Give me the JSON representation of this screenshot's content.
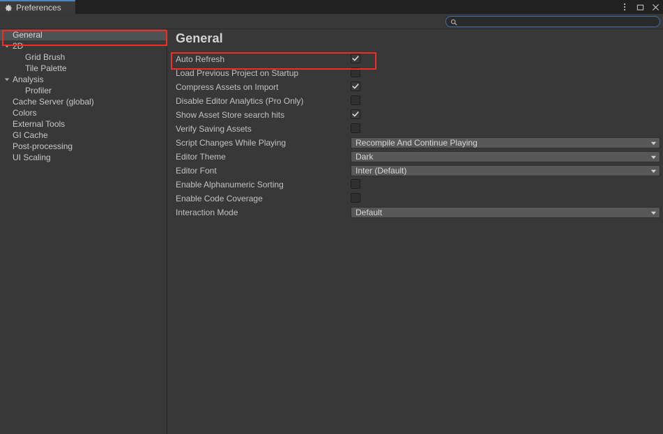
{
  "window": {
    "tab_label": "Preferences",
    "tab_icon": "gear-icon",
    "controls": [
      {
        "name": "more-options-icon",
        "glyph": "vertical-dots"
      },
      {
        "name": "maximize-icon",
        "glyph": "square"
      },
      {
        "name": "close-icon",
        "glyph": "x"
      }
    ],
    "accent_color": "#4a85c4"
  },
  "search": {
    "icon": "search-icon",
    "value": "",
    "placeholder": ""
  },
  "sidebar": {
    "items": [
      {
        "label": "General",
        "indent": 0,
        "twisty": "none",
        "selected": true
      },
      {
        "label": "2D",
        "indent": 0,
        "twisty": "expanded",
        "selected": false
      },
      {
        "label": "Grid Brush",
        "indent": 1,
        "twisty": "none",
        "selected": false
      },
      {
        "label": "Tile Palette",
        "indent": 1,
        "twisty": "none",
        "selected": false
      },
      {
        "label": "Analysis",
        "indent": 0,
        "twisty": "expanded",
        "selected": false
      },
      {
        "label": "Profiler",
        "indent": 1,
        "twisty": "none",
        "selected": false
      },
      {
        "label": "Cache Server (global)",
        "indent": 0,
        "twisty": "none",
        "selected": false
      },
      {
        "label": "Colors",
        "indent": 0,
        "twisty": "none",
        "selected": false
      },
      {
        "label": "External Tools",
        "indent": 0,
        "twisty": "none",
        "selected": false
      },
      {
        "label": "GI Cache",
        "indent": 0,
        "twisty": "none",
        "selected": false
      },
      {
        "label": "Post-processing",
        "indent": 0,
        "twisty": "none",
        "selected": false
      },
      {
        "label": "UI Scaling",
        "indent": 0,
        "twisty": "none",
        "selected": false
      }
    ]
  },
  "main": {
    "title": "General",
    "settings": [
      {
        "label": "Auto Refresh",
        "type": "checkbox",
        "checked": true
      },
      {
        "label": "Load Previous Project on Startup",
        "type": "checkbox",
        "checked": false
      },
      {
        "label": "Compress Assets on Import",
        "type": "checkbox",
        "checked": true
      },
      {
        "label": "Disable Editor Analytics (Pro Only)",
        "type": "checkbox",
        "checked": false
      },
      {
        "label": "Show Asset Store search hits",
        "type": "checkbox",
        "checked": true
      },
      {
        "label": "Verify Saving Assets",
        "type": "checkbox",
        "checked": false
      },
      {
        "label": "Script Changes While Playing",
        "type": "dropdown",
        "value": "Recompile And Continue Playing"
      },
      {
        "label": "Editor Theme",
        "type": "dropdown",
        "value": "Dark"
      },
      {
        "label": "Editor Font",
        "type": "dropdown",
        "value": "Inter (Default)"
      },
      {
        "label": "Enable Alphanumeric Sorting",
        "type": "checkbox",
        "checked": false
      },
      {
        "label": "Enable Code Coverage",
        "type": "checkbox",
        "checked": false
      },
      {
        "label": "Interaction Mode",
        "type": "dropdown",
        "value": "Default"
      }
    ]
  },
  "annotations": {
    "color": "#f52d20",
    "boxes": [
      {
        "target": "sidebar-item-general"
      },
      {
        "target": "setting-row-auto-refresh"
      }
    ]
  }
}
